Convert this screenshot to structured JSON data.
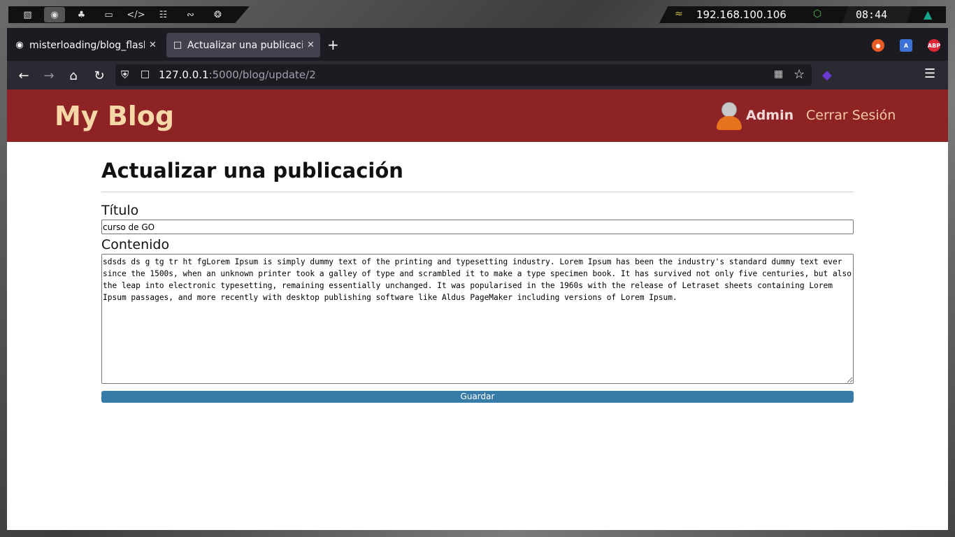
{
  "system_bar": {
    "workspaces": [
      "terminal-icon",
      "firefox-icon",
      "cherry-icon",
      "folder-icon",
      "code-icon",
      "docker-icon",
      "debian-icon",
      "ubuntu-icon"
    ],
    "ip_address": "192.168.100.106",
    "clock": "08:44"
  },
  "browser": {
    "tabs": [
      {
        "title": "misterloading/blog_flask",
        "active": false
      },
      {
        "title": "Actualizar una publicación",
        "active": true
      }
    ],
    "url_host": "127.0.0.1",
    "url_rest": ":5000/blog/update/2",
    "extensions": [
      "firefox-account-icon",
      "translate-icon",
      "abp-icon"
    ],
    "abp_label": "ABP"
  },
  "site": {
    "brand": "My Blog",
    "user_name": "Admin",
    "logout_label": "Cerrar Sesión"
  },
  "form": {
    "heading": "Actualizar una publicación",
    "title_label": "Título",
    "title_value": "curso de GO",
    "content_label": "Contenido",
    "content_value": "sdsds ds g tg tr ht fgLorem Ipsum is simply dummy text of the printing and typesetting industry. Lorem Ipsum has been the industry's standard dummy text ever since the 1500s, when an unknown printer took a galley of type and scrambled it to make a type specimen book. It has survived not only five centuries, but also the leap into electronic typesetting, remaining essentially unchanged. It was popularised in the 1960s with the release of Letraset sheets containing Lorem Ipsum passages, and more recently with desktop publishing software like Aldus PageMaker including versions of Lorem Ipsum.",
    "submit_label": "Guardar"
  },
  "colors": {
    "header_bg": "#8e2326",
    "brand_text": "#f6d7a7",
    "button_bg": "#377ba8"
  }
}
